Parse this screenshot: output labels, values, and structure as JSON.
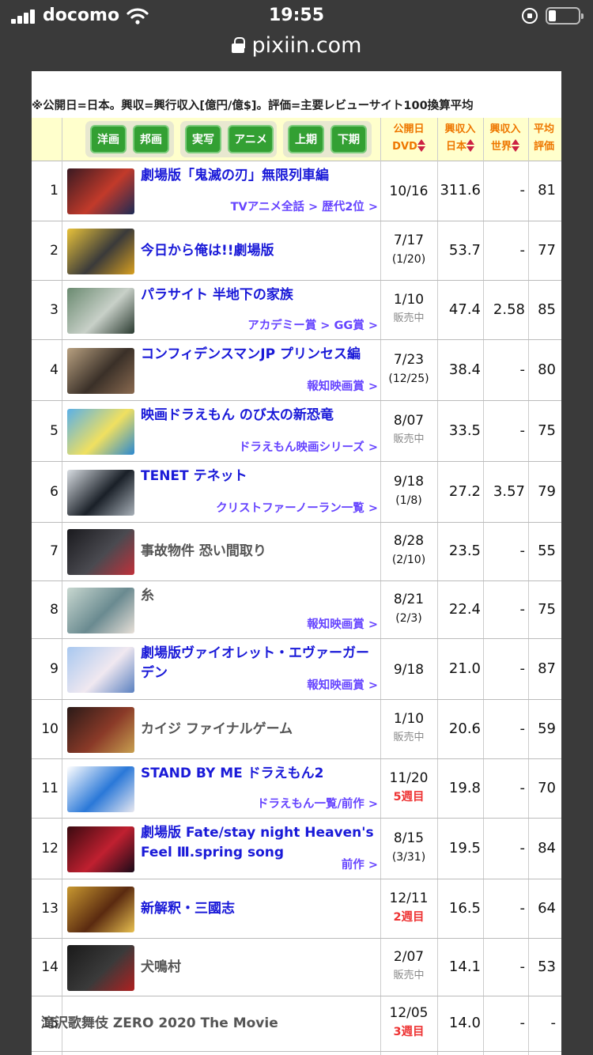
{
  "status_bar": {
    "carrier": "docomo",
    "time": "19:55"
  },
  "url_bar": {
    "domain": "pixiin.com"
  },
  "note": "※公開日=日本。興収=興行収入[億円/億$]。評価=主要レビューサイト100換算平均",
  "filters": [
    "洋画",
    "邦画",
    "実写",
    "アニメ",
    "上期",
    "下期"
  ],
  "columns": {
    "release_1": "公開日",
    "release_2": "DVD",
    "japan_1": "興収入",
    "japan_2": "日本",
    "world_1": "興収入",
    "world_2": "世界",
    "rating_1": "平均",
    "rating_2": "評価"
  },
  "movies": [
    {
      "rank": "1",
      "title": "劇場版「鬼滅の刃」無限列車編",
      "link": true,
      "sub": "TVアニメ全話 > 歴代2位 >",
      "date": "10/16",
      "dvd": "",
      "japan": "311.6",
      "world": "-",
      "rating": "81",
      "thumb_colors": [
        "#3a1a22",
        "#c23a2a",
        "#1c2a55"
      ]
    },
    {
      "rank": "2",
      "title": "今日から俺は!!劇場版",
      "link": true,
      "sub": "",
      "date": "7/17",
      "dvd": "(1/20)",
      "japan": "53.7",
      "world": "-",
      "rating": "77",
      "thumb_colors": [
        "#e8c23a",
        "#3a3a3a",
        "#d8a020"
      ]
    },
    {
      "rank": "3",
      "title": "パラサイト 半地下の家族",
      "link": true,
      "sub": "アカデミー賞 > GG賞 >",
      "date": "1/10",
      "dvd": "販売中",
      "japan": "47.4",
      "world": "2.58",
      "rating": "85",
      "thumb_colors": [
        "#6a8a70",
        "#c8d0c8",
        "#2a3a30"
      ]
    },
    {
      "rank": "4",
      "title": "コンフィデンスマンJP プリンセス編",
      "link": true,
      "sub": "報知映画賞 >",
      "date": "7/23",
      "dvd": "(12/25)",
      "japan": "38.4",
      "world": "-",
      "rating": "80",
      "thumb_colors": [
        "#b8a080",
        "#3a3028",
        "#8a6a50"
      ]
    },
    {
      "rank": "5",
      "title": "映画ドラえもん のび太の新恐竜",
      "link": true,
      "sub": "ドラえもん映画シリーズ >",
      "date": "8/07",
      "dvd": "販売中",
      "japan": "33.5",
      "world": "-",
      "rating": "75",
      "thumb_colors": [
        "#5ab0e8",
        "#f0e060",
        "#2a88d0"
      ]
    },
    {
      "rank": "6",
      "title": "TENET テネット",
      "link": true,
      "sub": "クリストファーノーラン一覧 >",
      "date": "9/18",
      "dvd": "(1/8)",
      "japan": "27.2",
      "world": "3.57",
      "rating": "79",
      "thumb_colors": [
        "#d8dde2",
        "#1a2028",
        "#a8b0b8"
      ]
    },
    {
      "rank": "7",
      "title": "事故物件 恐い間取り",
      "link": false,
      "sub": "",
      "date": "8/28",
      "dvd": "(2/10)",
      "japan": "23.5",
      "world": "-",
      "rating": "55",
      "thumb_colors": [
        "#1a1a1e",
        "#4a4a50",
        "#c0303a"
      ]
    },
    {
      "rank": "8",
      "title": "糸",
      "link": false,
      "sub": "報知映画賞 >",
      "date": "8/21",
      "dvd": "(2/3)",
      "japan": "22.4",
      "world": "-",
      "rating": "75",
      "thumb_colors": [
        "#c8d8d0",
        "#6a8a90",
        "#e8e0d8"
      ]
    },
    {
      "rank": "9",
      "title": "劇場版ヴァイオレット・エヴァーガーデン",
      "link": true,
      "sub": "報知映画賞 >",
      "date": "9/18",
      "dvd": "",
      "japan": "21.0",
      "world": "-",
      "rating": "87",
      "thumb_colors": [
        "#a8c8f0",
        "#f0e8f0",
        "#5a80c0"
      ]
    },
    {
      "rank": "10",
      "title": "カイジ ファイナルゲーム",
      "link": false,
      "sub": "",
      "date": "1/10",
      "dvd": "販売中",
      "japan": "20.6",
      "world": "-",
      "rating": "59",
      "thumb_colors": [
        "#2a1a18",
        "#8a3a28",
        "#c8a050"
      ]
    },
    {
      "rank": "11",
      "title": "STAND BY ME ドラえもん2",
      "link": true,
      "sub": "ドラえもん一覧/前作 >",
      "date": "11/20",
      "dvd": "5週目",
      "japan": "19.8",
      "world": "-",
      "rating": "70",
      "thumb_colors": [
        "#ffffff",
        "#2a78d8",
        "#e8e8f0"
      ]
    },
    {
      "rank": "12",
      "title": "劇場版 Fate/stay night Heaven's Feel Ⅲ.spring song",
      "link": true,
      "sub": "前作 >",
      "date": "8/15",
      "dvd": "(3/31)",
      "japan": "19.5",
      "world": "-",
      "rating": "84",
      "thumb_colors": [
        "#3a0a10",
        "#c02030",
        "#1a0a18"
      ]
    },
    {
      "rank": "13",
      "title": "新解釈・三國志",
      "link": true,
      "sub": "",
      "date": "12/11",
      "dvd": "2週目",
      "japan": "16.5",
      "world": "-",
      "rating": "64",
      "thumb_colors": [
        "#c89830",
        "#5a2a10",
        "#e8c050"
      ]
    },
    {
      "rank": "14",
      "title": "犬鳴村",
      "link": false,
      "sub": "",
      "date": "2/07",
      "dvd": "販売中",
      "japan": "14.1",
      "world": "-",
      "rating": "53",
      "thumb_colors": [
        "#1a1a1a",
        "#3a3a3a",
        "#b02020"
      ]
    },
    {
      "rank": "15",
      "title": "滝沢歌舞伎 ZERO 2020 The Movie",
      "link": false,
      "sub": "",
      "date": "12/05",
      "dvd": "3週目",
      "japan": "14.0",
      "world": "-",
      "rating": "-",
      "thumb_colors": []
    }
  ]
}
